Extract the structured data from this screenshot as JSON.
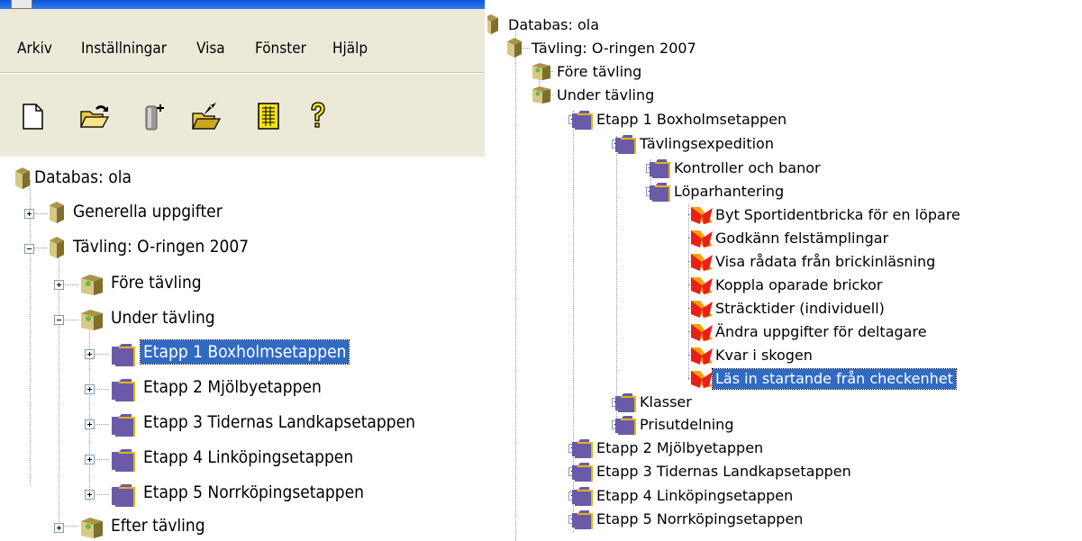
{
  "left": {
    "menu": [
      "Arkiv",
      "Inställningar",
      "Visa",
      "Fönster",
      "Hjälp"
    ],
    "toolbar_icons": [
      "new-document-icon",
      "open-folder-icon",
      "database-add-icon",
      "export-folder-icon",
      "report-icon",
      "help-icon"
    ],
    "tree": [
      {
        "label": "Databas: ola",
        "icon": "database-icon"
      },
      {
        "label": "Generella uppgifter",
        "icon": "database-icon"
      },
      {
        "label": "Tävling: O-ringen 2007",
        "icon": "database-icon"
      },
      {
        "label": "Före tävling",
        "icon": "phase-icon"
      },
      {
        "label": "Under tävling",
        "icon": "phase-icon"
      },
      {
        "label": "Etapp 1 Boxholmsetappen",
        "icon": "folder-icon",
        "selected": true
      },
      {
        "label": "Etapp 2 Mjölbyetappen",
        "icon": "folder-icon"
      },
      {
        "label": "Etapp 3 Tidernas Landkapsetappen",
        "icon": "folder-icon"
      },
      {
        "label": "Etapp 4 Linköpingsetappen",
        "icon": "folder-icon"
      },
      {
        "label": "Etapp 5 Norrköpingsetappen",
        "icon": "folder-icon"
      },
      {
        "label": "Efter tävling",
        "icon": "phase-icon"
      }
    ]
  },
  "right": {
    "tree": [
      {
        "label": "Databas: ola",
        "icon": "database-icon"
      },
      {
        "label": "Tävling: O-ringen 2007",
        "icon": "database-icon"
      },
      {
        "label": "Före tävling",
        "icon": "phase-icon"
      },
      {
        "label": "Under tävling",
        "icon": "phase-icon"
      },
      {
        "label": "Etapp 1 Boxholmsetappen",
        "icon": "folder-icon"
      },
      {
        "label": "Tävlingsexpedition",
        "icon": "folder-icon"
      },
      {
        "label": "Kontroller och banor",
        "icon": "folder-icon"
      },
      {
        "label": "Löparhantering",
        "icon": "folder-icon"
      },
      {
        "label": "Byt Sportidentbricka för en löpare",
        "icon": "action-icon"
      },
      {
        "label": "Godkänn felstämplingar",
        "icon": "action-icon"
      },
      {
        "label": "Visa rådata från brickinläsning",
        "icon": "action-icon"
      },
      {
        "label": "Koppla oparade brickor",
        "icon": "action-icon"
      },
      {
        "label": "Sträcktider (individuell)",
        "icon": "action-icon"
      },
      {
        "label": "Ändra uppgifter för deltagare",
        "icon": "action-icon"
      },
      {
        "label": "Kvar i skogen",
        "icon": "action-icon"
      },
      {
        "label": "Läs in startande från checkenhet",
        "icon": "action-icon",
        "selected": true
      },
      {
        "label": "Klasser",
        "icon": "folder-icon"
      },
      {
        "label": "Prisutdelning",
        "icon": "folder-icon"
      },
      {
        "label": "Etapp 2 Mjölbyetappen",
        "icon": "folder-icon"
      },
      {
        "label": "Etapp 3 Tidernas Landkapsetappen",
        "icon": "folder-icon"
      },
      {
        "label": "Etapp 4 Linköpingsetappen",
        "icon": "folder-icon"
      },
      {
        "label": "Etapp 5 Norrköpingsetappen",
        "icon": "folder-icon"
      }
    ]
  },
  "colors": {
    "selection": "#316ac5",
    "menubar": "#ece9d8",
    "folder_purple": "#6b5aa8",
    "folder_yellow": "#e0b800",
    "database_olive": "#a89548",
    "action_red": "#e8201a",
    "action_orange": "#f5a100"
  }
}
